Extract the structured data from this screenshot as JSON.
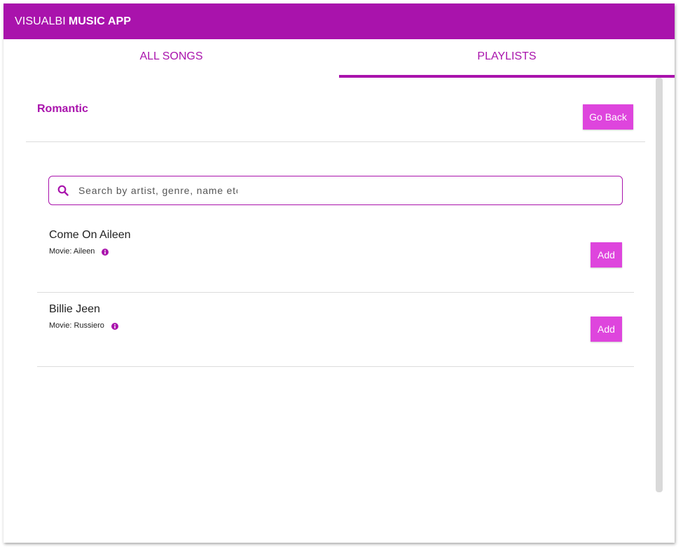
{
  "header": {
    "brand_light": "VISUALBI",
    "brand_bold": "MUSIC APP",
    "bg_color": "#a913ac"
  },
  "tabs": [
    {
      "label": "ALL SONGS",
      "active": false
    },
    {
      "label": "PLAYLISTS",
      "active": true
    }
  ],
  "playlist": {
    "title": "Romantic",
    "go_back_label": "Go Back"
  },
  "search": {
    "placeholder": "Search by artist, genre, name etc",
    "value": ""
  },
  "songs": [
    {
      "name": "Come On Aileen",
      "meta": "Movie: Aileen",
      "add_label": "Add"
    },
    {
      "name": "Billie Jeen",
      "meta": "Movie: Russiero",
      "add_label": "Add"
    }
  ],
  "colors": {
    "accent": "#a913ac",
    "button": "#de45dd"
  },
  "icons": {
    "search": "search-icon",
    "info": "info-icon"
  }
}
